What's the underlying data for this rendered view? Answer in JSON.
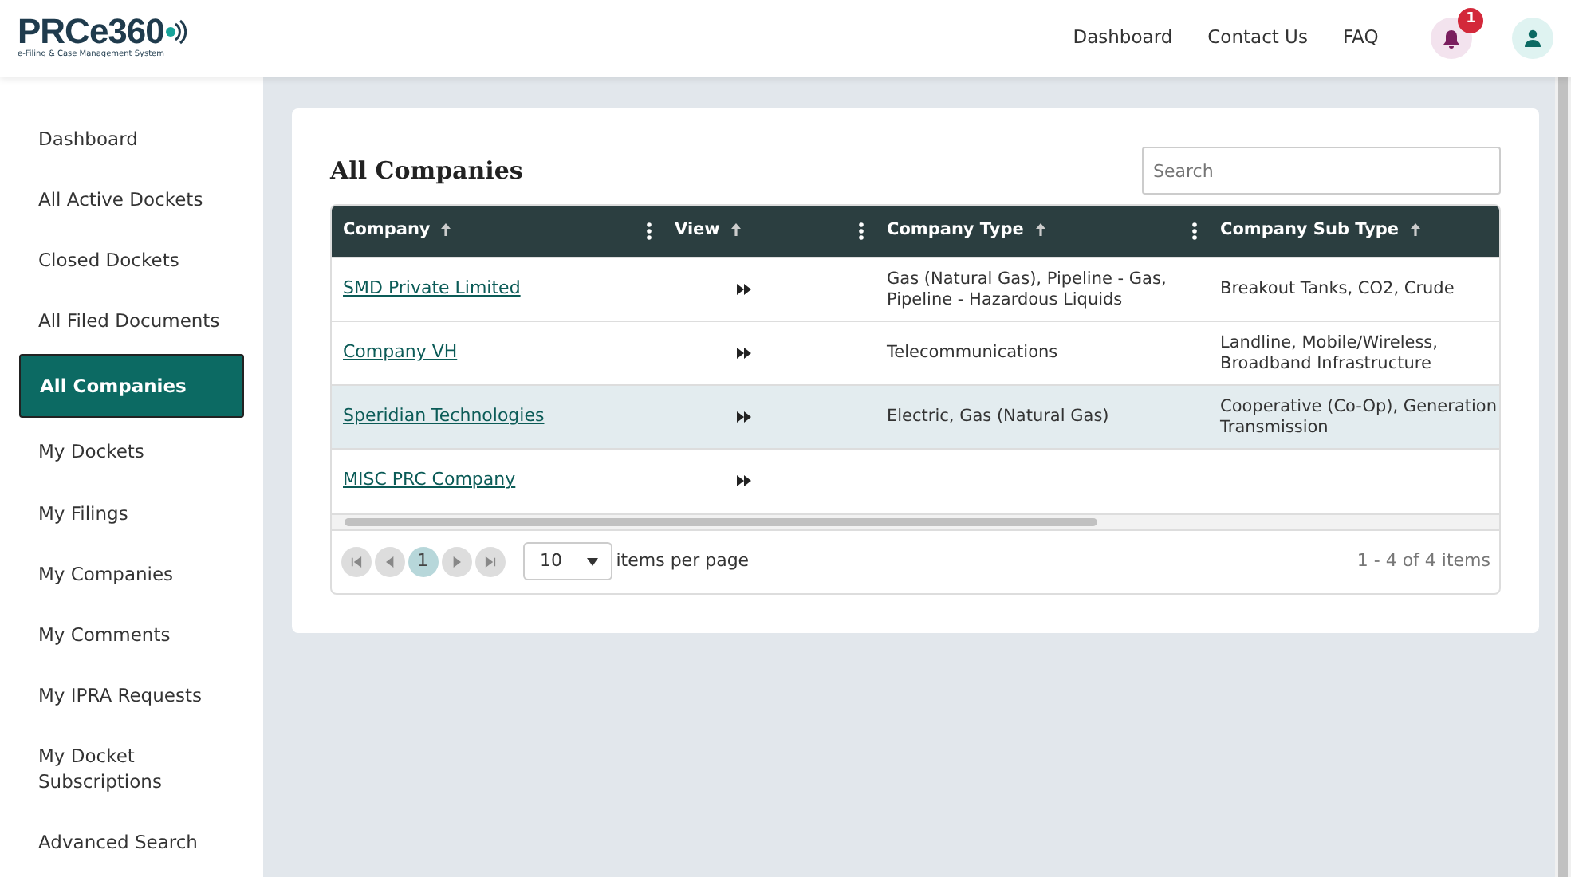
{
  "logo": {
    "name": "PRCe360",
    "tagline": "e-Filing & Case Management System"
  },
  "top_nav": [
    "Dashboard",
    "Contact Us",
    "FAQ"
  ],
  "notifications": {
    "count": "1"
  },
  "sidebar": {
    "items": [
      {
        "label": "Dashboard",
        "selected": false
      },
      {
        "label": "All Active Dockets",
        "selected": false
      },
      {
        "label": "Closed Dockets",
        "selected": false
      },
      {
        "label": "All Filed Documents",
        "selected": false
      },
      {
        "label": "All Companies",
        "selected": true
      },
      {
        "label": "My Dockets",
        "selected": false
      },
      {
        "label": "My Filings",
        "selected": false
      },
      {
        "label": "My Companies",
        "selected": false
      },
      {
        "label": "My Comments",
        "selected": false
      },
      {
        "label": "My IPRA Requests",
        "selected": false
      },
      {
        "label": "My Docket Subscriptions",
        "selected": false
      },
      {
        "label": "Advanced Search",
        "selected": false
      }
    ]
  },
  "page": {
    "title": "All Companies",
    "search": {
      "placeholder": "Search"
    }
  },
  "table": {
    "columns": [
      {
        "label": "Company",
        "menu": true
      },
      {
        "label": "View",
        "menu": true
      },
      {
        "label": "Company Type",
        "menu": true
      },
      {
        "label": "Company Sub Type",
        "menu": false
      }
    ],
    "rows": [
      {
        "company": "SMD Private Limited",
        "type": "Gas (Natural Gas), Pipeline - Gas, Pipeline - Hazardous Liquids",
        "sub_type": "Breakout Tanks, CO2, Crude",
        "selected": false
      },
      {
        "company": "Company VH",
        "type": "Telecommunications",
        "sub_type": "Landline, Mobile/Wireless, Broadband Infrastructure",
        "selected": false
      },
      {
        "company": "Speridian Technologies",
        "type": "Electric, Gas (Natural Gas)",
        "sub_type": "Cooperative (Co-Op), Generation",
        "sub_type_2": "Transmission",
        "selected": true
      },
      {
        "company": "MISC PRC Company",
        "selected": false
      }
    ]
  },
  "pager": {
    "current_page": "1",
    "page_size": "10",
    "page_size_label": "items per page",
    "summary": "1 - 4 of 4 items"
  }
}
